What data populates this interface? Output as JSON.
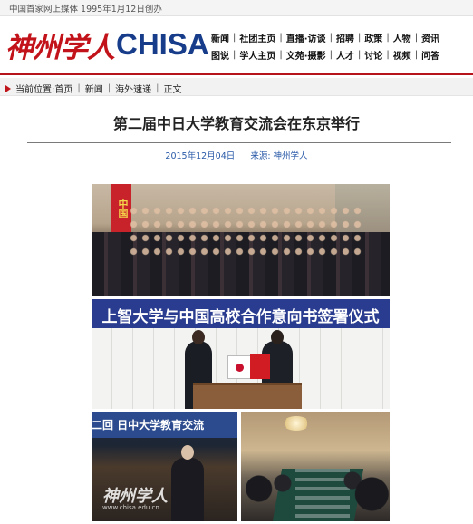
{
  "topbar": {
    "slogan": "中国首家网上媒体  1995年1月12日创办"
  },
  "header": {
    "logo_cn": "神州学人",
    "logo_en": "CHISA"
  },
  "nav": {
    "row1": [
      "新闻",
      "社团主页",
      "直播·访谈",
      "招聘",
      "政策",
      "人物",
      "资讯"
    ],
    "row2": [
      "图说",
      "学人主页",
      "文苑·摄影",
      "人才",
      "讨论",
      "视频",
      "问答"
    ],
    "separator": "|"
  },
  "breadcrumb": {
    "label": "当前位置:",
    "items": [
      "首页",
      "新闻",
      "海外速递",
      "正文"
    ],
    "separator": "|"
  },
  "article": {
    "title": "第二届中日大学教育交流会在东京举行",
    "date": "2015年12月04日",
    "source_label": "来源:",
    "source": "神州学人"
  },
  "photos": {
    "photo1_flag_text": "中国",
    "photo2_banner": "上智大学与中国高校合作意向书签署仪式",
    "photo3_banner": "二回  日中大学教育交流",
    "photo3_watermark_cn": "神州学人",
    "photo3_watermark_url": "www.chisa.edu.cn"
  },
  "colors": {
    "brand_red": "#b4141a",
    "brand_blue": "#163c8a",
    "link_blue": "#2a5aa8"
  }
}
